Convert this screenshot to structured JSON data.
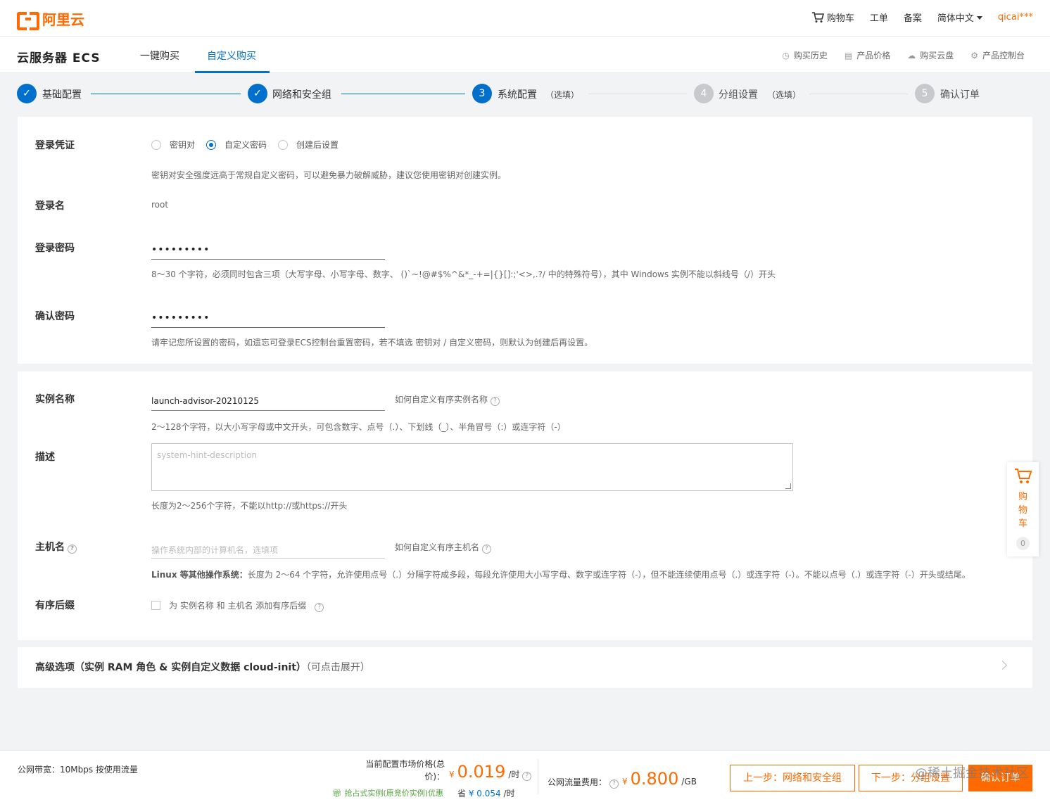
{
  "header": {
    "logo_text": "阿里云",
    "nav": {
      "cart": "购物车",
      "ticket": "工单",
      "filing": "备案",
      "language": "简体中文",
      "user": "qicai***"
    }
  },
  "subheader": {
    "product": "云服务器 ECS",
    "tabs": [
      "一键购买",
      "自定义购买"
    ],
    "active_tab": "自定义购买",
    "links": {
      "history": "购买历史",
      "price": "产品价格",
      "disk": "购买云盘",
      "console": "产品控制台"
    }
  },
  "steps": [
    {
      "num": "1",
      "label": "基础配置",
      "status": "done",
      "optional": ""
    },
    {
      "num": "2",
      "label": "网络和安全组",
      "status": "done",
      "optional": ""
    },
    {
      "num": "3",
      "label": "系统配置",
      "status": "current",
      "optional": "（选填）"
    },
    {
      "num": "4",
      "label": "分组设置",
      "status": "todo",
      "optional": "（选填）"
    },
    {
      "num": "5",
      "label": "确认订单",
      "status": "todo",
      "optional": ""
    }
  ],
  "login": {
    "credential_label": "登录凭证",
    "options": [
      "密钥对",
      "自定义密码",
      "创建后设置"
    ],
    "selected": "自定义密码",
    "credential_hint": "密钥对安全强度远高于常规自定义密码，可以避免暴力破解威胁，建议您使用密钥对创建实例。",
    "username_label": "登录名",
    "username": "root",
    "password_label": "登录密码",
    "password_value": "•••••••••",
    "password_hint": "8～30 个字符，必须同时包含三项（大写字母、小写字母、数字、 ()`~!@#$%^&*_-+=|{}[]:;'<>,.?/ 中的特殊符号），其中 Windows 实例不能以斜线号（/）开头",
    "confirm_label": "确认密码",
    "confirm_value": "•••••••••",
    "confirm_hint": "请牢记您所设置的密码，如遗忘可登录ECS控制台重置密码，若不填选 密钥对 / 自定义密码，则默认为创建后再设置。"
  },
  "instance": {
    "name_label": "实例名称",
    "name_value": "launch-advisor-20210125",
    "name_link": "如何自定义有序实例名称",
    "name_hint": "2～128个字符，以大小写字母或中文开头，可包含数字、点号（.）、下划线（_）、半角冒号（:）或连字符（-）",
    "desc_label": "描述",
    "desc_placeholder": "system-hint-description",
    "desc_hint": "长度为2～256个字符，不能以http://或https://开头",
    "host_label": "主机名",
    "host_placeholder": "操作系统内部的计算机名，选填项",
    "host_link": "如何自定义有序主机名",
    "host_hint_os": "Linux 等其他操作系统：",
    "host_hint": "长度为 2～64 个字符，允许使用点号（.）分隔字符成多段，每段允许使用大小写字母、数字或连字符（-），但不能连续使用点号（.）或连字符（-）。不能以点号（.）或连字符（-）开头或结尾。",
    "suffix_label": "有序后缀",
    "suffix_checkbox": "为 实例名称 和 主机名 添加有序后缀"
  },
  "advanced": {
    "title": "高级选项（实例 RAM 角色 & 实例自定义数据 cloud-init）",
    "expand": "（可点击展开）"
  },
  "floating_cart": {
    "label": [
      "购",
      "物",
      "车"
    ],
    "count": "0"
  },
  "footer": {
    "bandwidth": "公网带宽：10Mbps 按使用流量",
    "price_label_1": "当前配置市场价格(总",
    "price_label_2": "价)：",
    "currency": "¥",
    "price": "0.019",
    "price_unit": "/时",
    "promo": "抢占式实例(原竞价实例)优惠",
    "save_label": "省",
    "save_value": "¥ 0.054",
    "save_unit": "/时",
    "traffic_label": "公网流量费用：",
    "traffic_price": "0.800",
    "traffic_unit": "/GB",
    "prev_button": "上一步：网络和安全组",
    "next_button": "下一步：分组设置",
    "confirm_button": "确认订单",
    "watermark": "@稀土掘金技术社区"
  }
}
